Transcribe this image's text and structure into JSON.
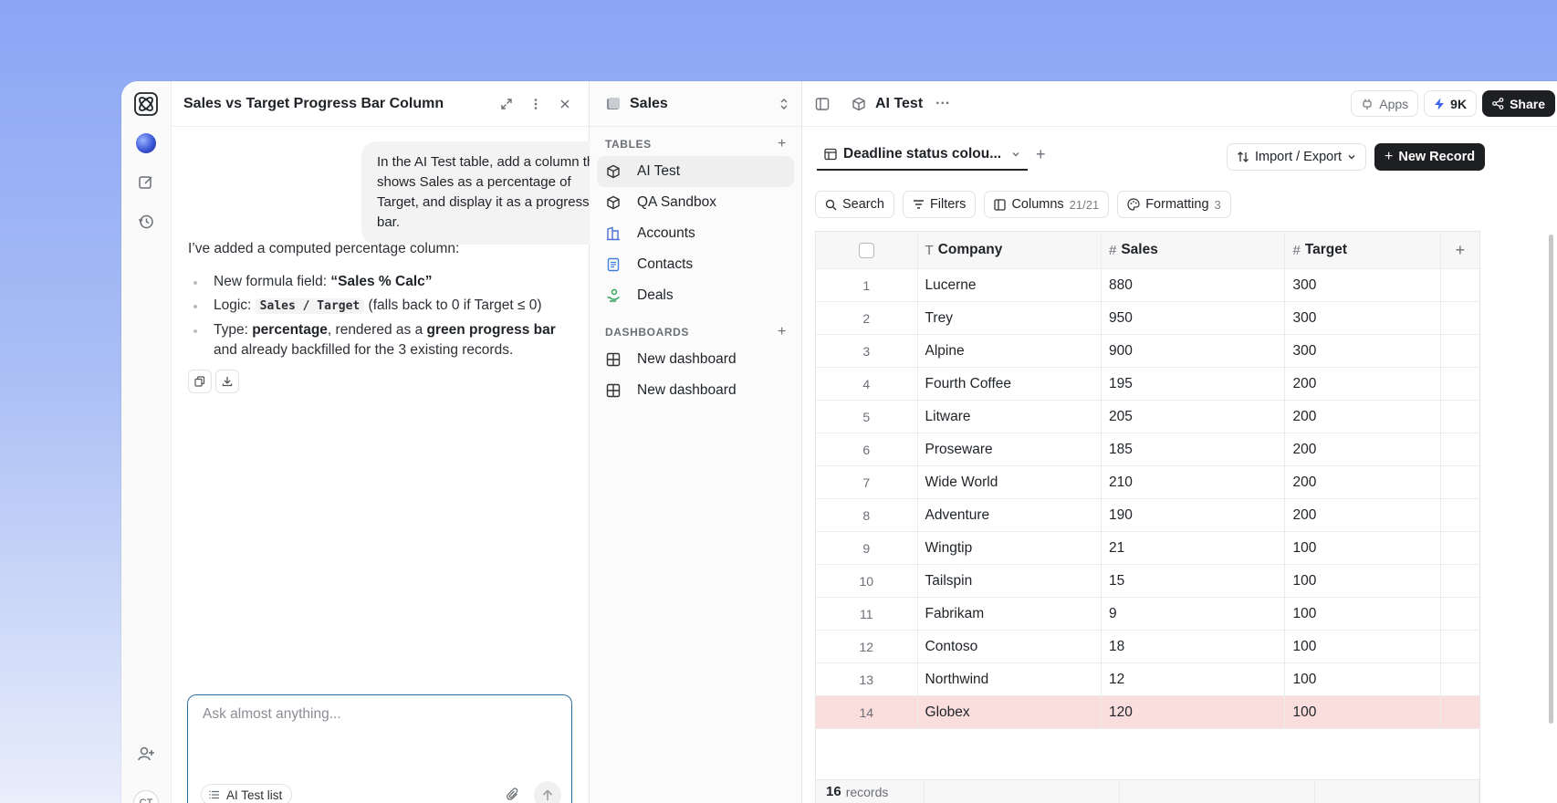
{
  "chat": {
    "title": "Sales vs Target Progress Bar Column",
    "user_message": "In the AI Test table, add a column that shows Sales as a percentage of Target, and display it as a progress bar.",
    "assistant_intro": "I’ve added a computed percentage column:",
    "bullet1_prefix": "New formula field: ",
    "bullet1_value": "“Sales % Calc”",
    "bullet2_prefix": "Logic: ",
    "bullet2_code": "Sales / Target",
    "bullet2_suffix": " (falls back to 0 if Target ≤ 0)",
    "bullet3_prefix": "Type: ",
    "bullet3_type": "percentage",
    "bullet3_mid": ", rendered as a ",
    "bullet3_bar": "green progress bar",
    "bullet3_suffix": " and already backfilled for the 3 existing records.",
    "composer_placeholder": "Ask almost anything...",
    "context_chip": "AI Test list"
  },
  "rail": {
    "avatar_initials": "CT"
  },
  "sidebar": {
    "base_name": "Sales",
    "tables_label": "TABLES",
    "tables": [
      {
        "label": "AI Test",
        "icon": "cube-icon"
      },
      {
        "label": "QA Sandbox",
        "icon": "cube-icon"
      },
      {
        "label": "Accounts",
        "icon": "building-icon"
      },
      {
        "label": "Contacts",
        "icon": "contact-icon"
      },
      {
        "label": "Deals",
        "icon": "handshake-icon"
      }
    ],
    "dashboards_label": "DASHBOARDS",
    "dashboards": [
      {
        "label": "New dashboard",
        "icon": "grid-icon"
      },
      {
        "label": "New dashboard",
        "icon": "grid-icon"
      }
    ]
  },
  "topbar": {
    "table_name": "AI Test",
    "more": "···",
    "apps_label": "Apps",
    "credits": "9K",
    "share_label": "Share"
  },
  "view": {
    "tab_label": "Deadline status colou...",
    "import_export_label": "Import / Export",
    "new_record_label": "New Record",
    "search_label": "Search",
    "filters_label": "Filters",
    "columns_label": "Columns",
    "columns_count": "21/21",
    "formatting_label": "Formatting",
    "formatting_count": "3"
  },
  "table": {
    "columns": [
      "Company",
      "Sales",
      "Target"
    ],
    "rows": [
      {
        "n": "1",
        "company": "Lucerne",
        "sales": "880",
        "target": "300"
      },
      {
        "n": "2",
        "company": "Trey",
        "sales": "950",
        "target": "300"
      },
      {
        "n": "3",
        "company": "Alpine",
        "sales": "900",
        "target": "300"
      },
      {
        "n": "4",
        "company": "Fourth Coffee",
        "sales": "195",
        "target": "200"
      },
      {
        "n": "5",
        "company": "Litware",
        "sales": "205",
        "target": "200"
      },
      {
        "n": "6",
        "company": "Proseware",
        "sales": "185",
        "target": "200"
      },
      {
        "n": "7",
        "company": "Wide World",
        "sales": "210",
        "target": "200"
      },
      {
        "n": "8",
        "company": "Adventure",
        "sales": "190",
        "target": "200"
      },
      {
        "n": "9",
        "company": "Wingtip",
        "sales": "21",
        "target": "100"
      },
      {
        "n": "10",
        "company": "Tailspin",
        "sales": "15",
        "target": "100"
      },
      {
        "n": "11",
        "company": "Fabrikam",
        "sales": "9",
        "target": "100"
      },
      {
        "n": "12",
        "company": "Contoso",
        "sales": "18",
        "target": "100"
      },
      {
        "n": "13",
        "company": "Northwind",
        "sales": "12",
        "target": "100"
      },
      {
        "n": "14",
        "company": "Globex",
        "sales": "120",
        "target": "100"
      }
    ],
    "highlighted_row": "14",
    "highlight_color": "#f9dedd",
    "record_count": "16",
    "record_label": "records"
  },
  "colors": {
    "accent_dark": "#1d1f22",
    "composer_border": "#2f6fa0",
    "credits_bolt": "#3a64e8"
  }
}
